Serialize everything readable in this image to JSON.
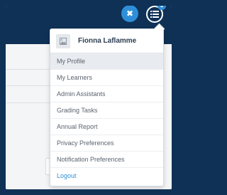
{
  "header": {
    "close_glyph": "✖",
    "notification_count": "1",
    "icons": [
      "close-icon",
      "list-menu-icon",
      "image-icon"
    ]
  },
  "user": {
    "name": "Fionna Laflamme"
  },
  "menu": {
    "items": [
      {
        "label": "My Profile",
        "active": true
      },
      {
        "label": "My Learners"
      },
      {
        "label": "Admin Assistants"
      },
      {
        "label": "Grading Tasks"
      },
      {
        "label": "Annual Report"
      },
      {
        "label": "Privacy Preferences"
      },
      {
        "label": "Notification Preferences"
      }
    ],
    "logout_label": "Logout"
  },
  "colors": {
    "navy": "#0f3156",
    "accent": "#2e8fd8",
    "active_bg": "#e8ebef"
  }
}
